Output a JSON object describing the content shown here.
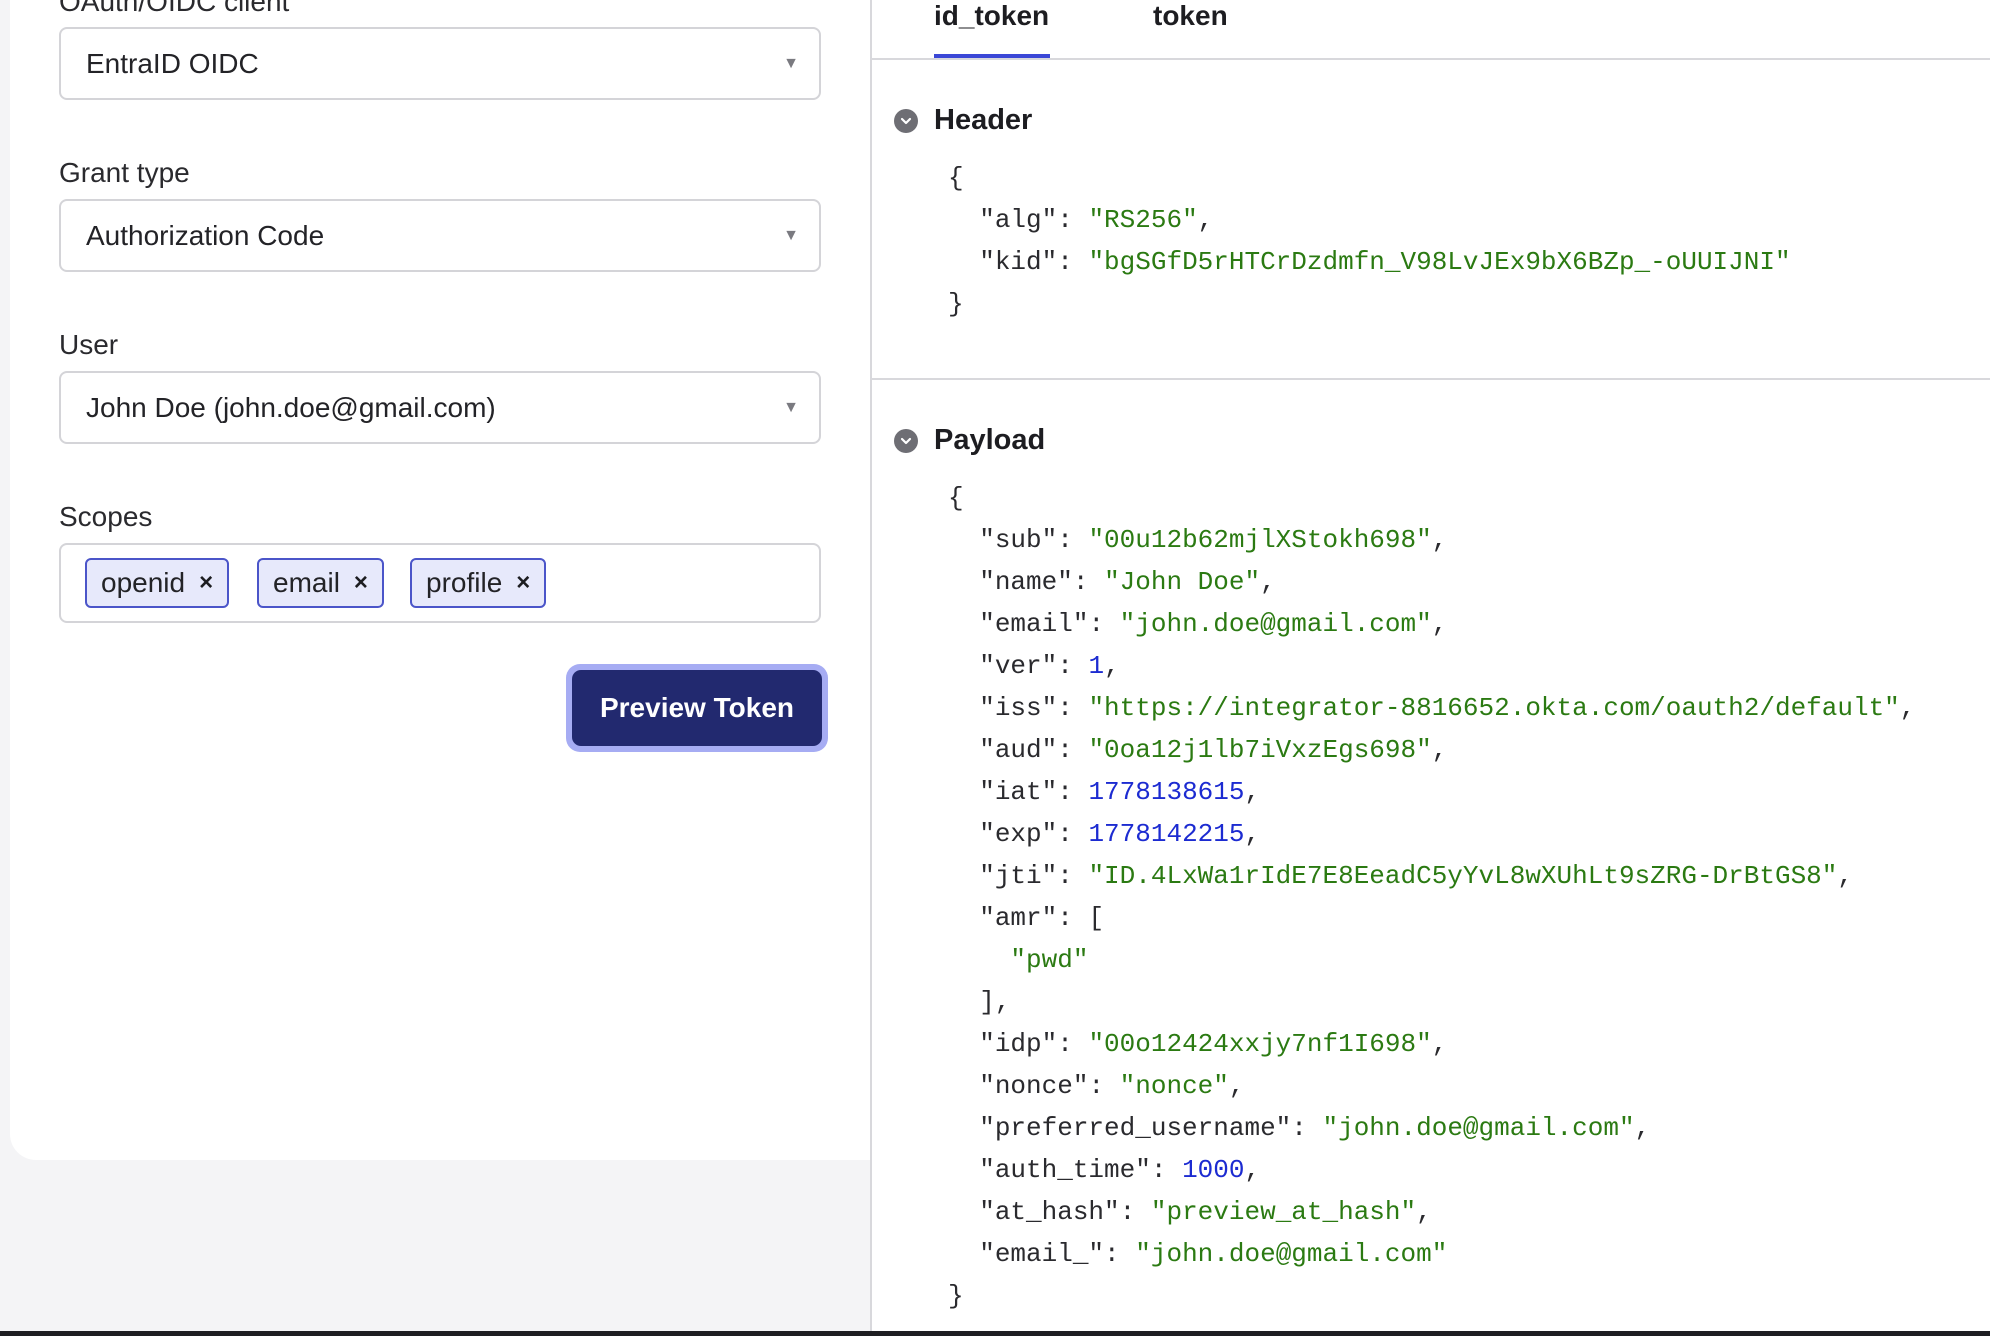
{
  "form": {
    "client_label": "OAuth/OIDC client",
    "client_value": "EntraID OIDC",
    "grant_label": "Grant type",
    "grant_value": "Authorization Code",
    "user_label": "User",
    "user_value": "John Doe (john.doe@gmail.com)",
    "scopes_label": "Scopes",
    "scopes": [
      "openid",
      "email",
      "profile"
    ],
    "remove_glyph": "×",
    "caret_glyph": "▼",
    "preview_button": "Preview Token"
  },
  "tabs": [
    {
      "label": "id_token",
      "active": true
    },
    {
      "label": "token",
      "active": false
    }
  ],
  "header_section": {
    "title": "Header",
    "lines": [
      {
        "indent": 0,
        "text": "{"
      },
      {
        "indent": 1,
        "key": "alg",
        "value": "RS256",
        "type": "string",
        "comma": true
      },
      {
        "indent": 1,
        "key": "kid",
        "value": "bgSGfD5rHTCrDzdmfn_V98LvJEx9bX6BZp_-oUUIJNI",
        "type": "string",
        "comma": false
      },
      {
        "indent": 0,
        "text": "}"
      }
    ]
  },
  "payload_section": {
    "title": "Payload",
    "lines": [
      {
        "indent": 0,
        "text": "{"
      },
      {
        "indent": 1,
        "key": "sub",
        "value": "00u12b62mjlXStokh698",
        "type": "string",
        "comma": true
      },
      {
        "indent": 1,
        "key": "name",
        "value": "John Doe",
        "type": "string",
        "comma": true
      },
      {
        "indent": 1,
        "key": "email",
        "value": "john.doe@gmail.com",
        "type": "string",
        "comma": true
      },
      {
        "indent": 1,
        "key": "ver",
        "value": "1",
        "type": "number",
        "comma": true
      },
      {
        "indent": 1,
        "key": "iss",
        "value": "https://integrator-8816652.okta.com/oauth2/default",
        "type": "string",
        "comma": true
      },
      {
        "indent": 1,
        "key": "aud",
        "value": "0oa12j1lb7iVxzEgs698",
        "type": "string",
        "comma": true
      },
      {
        "indent": 1,
        "key": "iat",
        "value": "1778138615",
        "type": "number",
        "comma": true
      },
      {
        "indent": 1,
        "key": "exp",
        "value": "1778142215",
        "type": "number",
        "comma": true
      },
      {
        "indent": 1,
        "key": "jti",
        "value": "ID.4LxWa1rIdE7E8EeadC5yYvL8wXUhLt9sZRG-DrBtGS8",
        "type": "string",
        "comma": true
      },
      {
        "indent": 1,
        "key": "amr",
        "open": "["
      },
      {
        "indent": 2,
        "value": "pwd",
        "type": "string",
        "comma": false
      },
      {
        "indent": 1,
        "text": "],"
      },
      {
        "indent": 1,
        "key": "idp",
        "value": "00o12424xxjy7nf1I698",
        "type": "string",
        "comma": true
      },
      {
        "indent": 1,
        "key": "nonce",
        "value": "nonce",
        "type": "string",
        "comma": true
      },
      {
        "indent": 1,
        "key": "preferred_username",
        "value": "john.doe@gmail.com",
        "type": "string",
        "comma": true
      },
      {
        "indent": 1,
        "key": "auth_time",
        "value": "1000",
        "type": "number",
        "comma": true
      },
      {
        "indent": 1,
        "key": "at_hash",
        "value": "preview_at_hash",
        "type": "string",
        "comma": true
      },
      {
        "indent": 1,
        "key": "email_",
        "value": "john.doe@gmail.com",
        "type": "string",
        "comma": false
      },
      {
        "indent": 0,
        "text": "}"
      }
    ]
  },
  "colors": {
    "accent": "#3b47d6",
    "button_bg": "#22296f",
    "button_ring": "#a6acf3",
    "json_string": "#2b7a12",
    "json_number": "#1c2bd1"
  }
}
